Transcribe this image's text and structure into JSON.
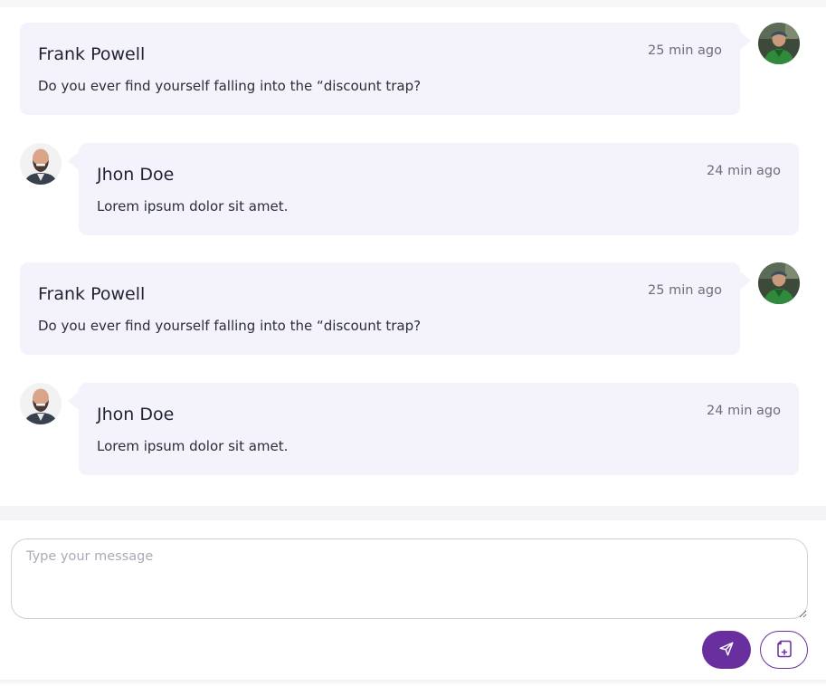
{
  "conversation": {
    "messages": [
      {
        "direction": "outgoing",
        "sender": "Frank Powell",
        "time": "25 min ago",
        "text": "Do you ever find yourself falling into the “discount trap?",
        "avatar": "man-green-jacket-avatar"
      },
      {
        "direction": "incoming",
        "sender": "Jhon Doe",
        "time": "24 min ago",
        "text": "Lorem ipsum dolor sit amet.",
        "avatar": "bald-bearded-man-avatar"
      },
      {
        "direction": "outgoing",
        "sender": "Frank Powell",
        "time": "25 min ago",
        "text": "Do you ever find yourself falling into the “discount trap?",
        "avatar": "man-green-jacket-avatar"
      },
      {
        "direction": "incoming",
        "sender": "Jhon Doe",
        "time": "24 min ago",
        "text": "Lorem ipsum dolor sit amet.",
        "avatar": "bald-bearded-man-avatar"
      }
    ]
  },
  "composer": {
    "placeholder": "Type your message",
    "value": "",
    "send_icon": "paper-plane-icon",
    "attach_icon": "file-attach-icon"
  },
  "colors": {
    "accent": "#6a2f9e",
    "bubble_bg": "#f4f3fb",
    "timestamp": "#6b6e7d",
    "placeholder": "#a9abb6"
  }
}
